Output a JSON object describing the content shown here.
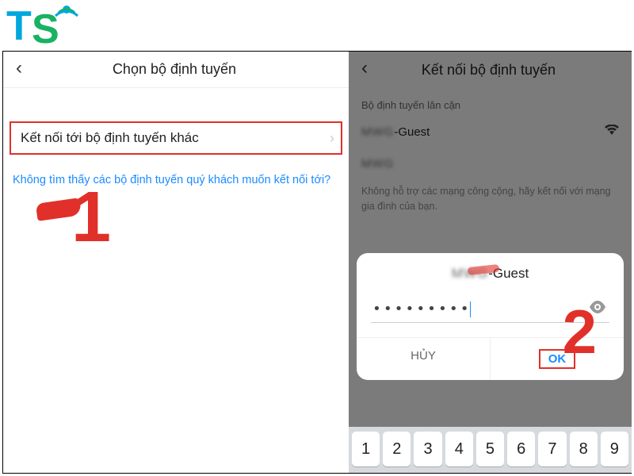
{
  "logo": {
    "letter1": "T",
    "letter2": "S"
  },
  "left": {
    "title": "Chọn bộ định tuyến",
    "connect_other": "Kết nối tới bộ định tuyến khác",
    "not_found_link": "Không tìm thấy các bộ định tuyến quý khách muốn kết nối tới?",
    "step_number": "1"
  },
  "right": {
    "title": "Kết nối bộ định tuyến",
    "nearby_label": "Bộ định tuyến lân cận",
    "network_prefix_blur": "MWG",
    "network_suffix": "-Guest",
    "network2_blur": "MWG",
    "hint": "Không hỗ trợ các mạng công cộng, hãy kết nối với mạng gia đình của bạn.",
    "step_number": "2"
  },
  "dialog": {
    "title_prefix_blur": "MWG",
    "title_suffix": "-Guest",
    "password_dots": "•••••••••",
    "cancel": "HỦY",
    "ok": "OK"
  },
  "keyboard": {
    "keys": [
      "1",
      "2",
      "3",
      "4",
      "5",
      "6",
      "7",
      "8",
      "9"
    ]
  },
  "colors": {
    "accent_red": "#e1302a",
    "link_blue": "#1a8cff"
  }
}
